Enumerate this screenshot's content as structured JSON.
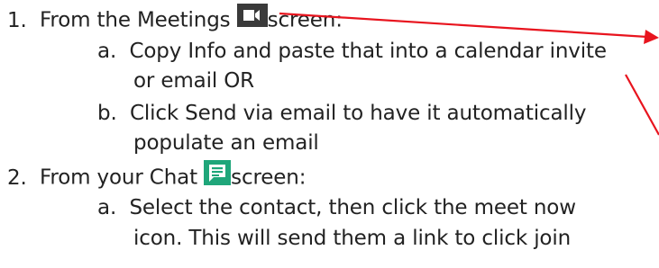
{
  "list": {
    "item1": {
      "number": "1.",
      "prefix": "From the Meetings",
      "suffix": "screen:",
      "icon": "video-camera-icon",
      "a": {
        "letter": "a.",
        "line1": "Copy Info and paste that into a calendar invite",
        "line2": "or email OR"
      },
      "b": {
        "letter": "b.",
        "line1": "Click Send via email to have it automatically",
        "line2": "populate an email"
      }
    },
    "item2": {
      "number": "2.",
      "prefix": "From your Chat",
      "suffix": "screen:",
      "icon": "chat-message-icon",
      "a": {
        "letter": "a.",
        "line1": "Select the contact, then click the meet now",
        "line2": "icon. This will send them a link to click join"
      }
    }
  },
  "colors": {
    "text": "#222222",
    "meetings_icon_bg": "#3a3a3a",
    "chat_icon_bg": "#1fa67a",
    "arrow": "#e8141e"
  }
}
